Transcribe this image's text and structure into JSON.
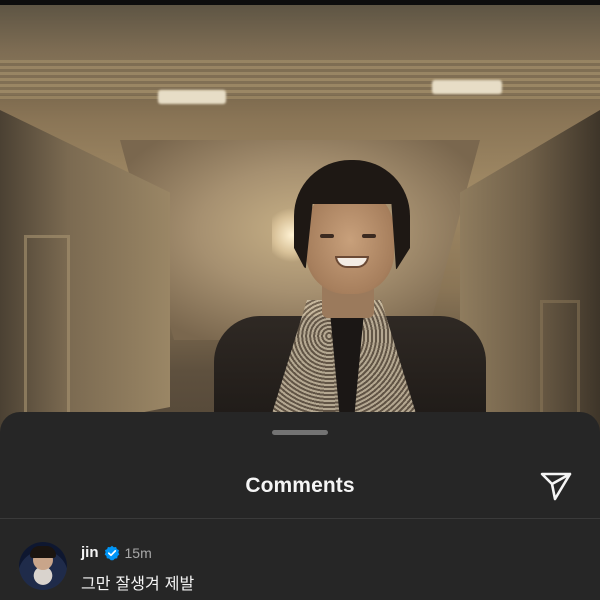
{
  "sheet": {
    "title": "Comments"
  },
  "icons": {
    "send": "paper-plane-icon",
    "verified": "verified-badge-icon",
    "drag_handle": "drag-handle"
  },
  "comments": [
    {
      "username": "jin",
      "time": "15m",
      "text": "그만 잘생겨 제발",
      "verified": true
    }
  ],
  "colors": {
    "sheet_bg": "#262626",
    "text_primary": "#f5f5f5",
    "text_secondary": "#a8a8a8",
    "verified_blue": "#0095f6"
  }
}
